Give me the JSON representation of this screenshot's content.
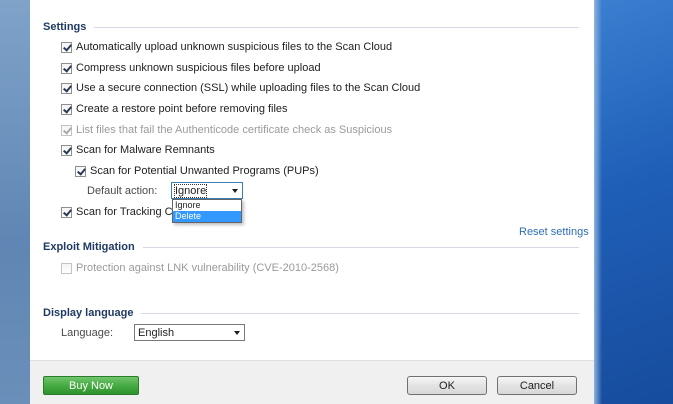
{
  "settings": {
    "title": "Settings",
    "options": [
      {
        "label": "Automatically upload unknown suspicious files to the Scan Cloud",
        "checked": true,
        "enabled": true
      },
      {
        "label": "Compress unknown suspicious files before upload",
        "checked": true,
        "enabled": true
      },
      {
        "label": "Use a secure connection (SSL) while uploading files to the Scan Cloud",
        "checked": true,
        "enabled": true
      },
      {
        "label": "Create a restore point before removing files",
        "checked": true,
        "enabled": true
      },
      {
        "label": "List files that fail the Authenticode certificate check as Suspicious",
        "checked": true,
        "enabled": false
      },
      {
        "label": "Scan for Malware Remnants",
        "checked": true,
        "enabled": true
      },
      {
        "label": "Scan for Potential Unwanted Programs (PUPs)",
        "checked": true,
        "enabled": true
      },
      {
        "label": "Scan for Tracking Cook",
        "checked": true,
        "enabled": true
      }
    ],
    "default_action_label": "Default action:",
    "default_action_value": "Ignore",
    "default_action_options": [
      "Ignore",
      "Delete"
    ],
    "reset_link": "Reset settings"
  },
  "exploit": {
    "title": "Exploit Mitigation",
    "option": {
      "label": "Protection against LNK vulnerability (CVE-2010-2568)",
      "checked": false,
      "enabled": false
    }
  },
  "display": {
    "title": "Display language",
    "language_label": "Language:",
    "language_value": "English"
  },
  "footer": {
    "buy_label": "Buy Now",
    "ok_label": "OK",
    "cancel_label": "Cancel"
  },
  "colors": {
    "accent_link": "#2f6db5",
    "section_title": "#1f3b63",
    "buy_button": "#43a83f",
    "highlight": "#3399ff"
  }
}
